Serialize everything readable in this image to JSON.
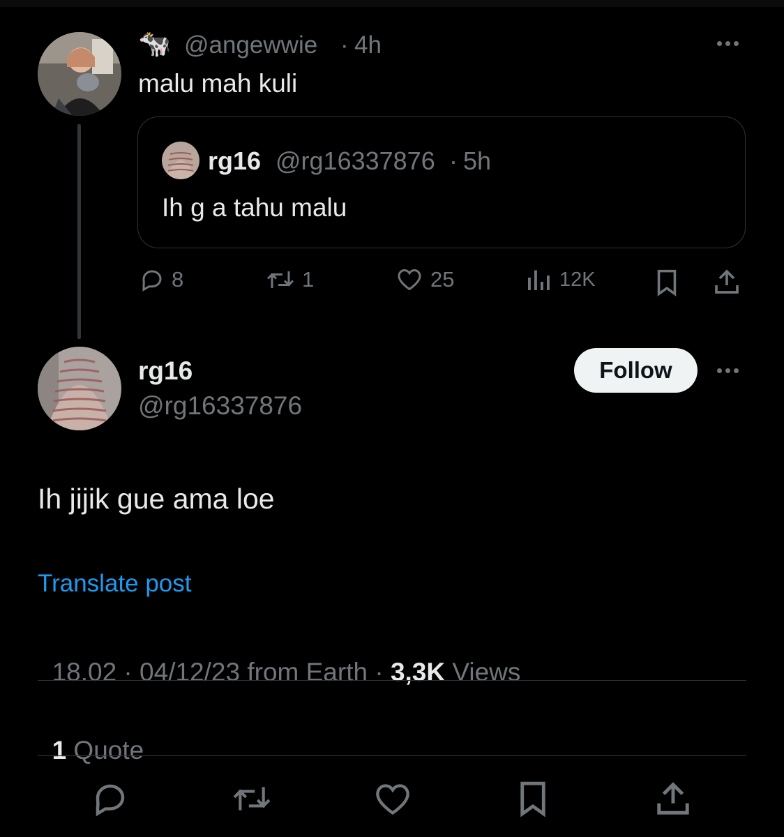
{
  "parent_post": {
    "emoji": "🐄",
    "handle": "@angewwie",
    "time": "4h",
    "text": "malu mah kuli",
    "quoted": {
      "name": "rg16",
      "handle": "@rg16337876",
      "time": "5h",
      "text": "Ih g a tahu malu"
    },
    "stats": {
      "replies": "8",
      "reposts": "1",
      "likes": "25",
      "views": "12K"
    }
  },
  "main_post": {
    "name": "rg16",
    "handle": "@rg16337876",
    "follow_label": "Follow",
    "text": "Ih jijik gue ama loe",
    "translate_label": "Translate post",
    "meta_time": "18.02 · 04/12/23 from Earth · ",
    "views_count": "3,3K",
    "views_label": " Views",
    "quote_count": "1",
    "quote_label": " Quote"
  },
  "colors": {
    "background": "#000000",
    "text": "#e7e9ea",
    "muted": "#71767b",
    "link": "#1d9bf0",
    "border": "#2f3336"
  },
  "icons": [
    "reply-icon",
    "repost-icon",
    "like-icon",
    "views-icon",
    "bookmark-icon",
    "share-icon",
    "more-icon"
  ]
}
